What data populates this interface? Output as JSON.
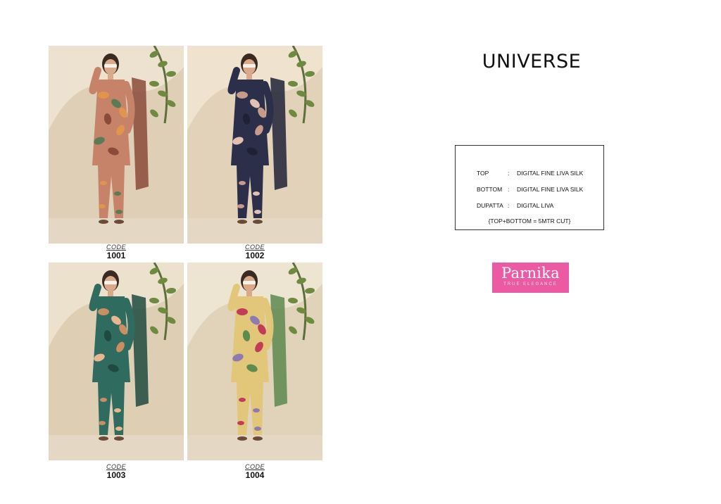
{
  "title": "UNIVERSE",
  "products": [
    {
      "code_word": "CODE",
      "code": "1001",
      "palette": {
        "bg": "#ece2cf",
        "arch": "#d9c8ab",
        "base": "#c7836a",
        "print_a": "#e0944c",
        "print_b": "#5b7a55",
        "print_c": "#8b4a3a"
      }
    },
    {
      "code_word": "CODE",
      "code": "1002",
      "palette": {
        "bg": "#efe3d0",
        "arch": "#ddcbb0",
        "base": "#2b2f4a",
        "print_a": "#c89a8a",
        "print_b": "#e2c1b4",
        "print_c": "#1f2236"
      }
    },
    {
      "code_word": "CODE",
      "code": "1003",
      "palette": {
        "bg": "#ece1cd",
        "arch": "#d8c6a9",
        "base": "#2f6b5e",
        "print_a": "#c98e62",
        "print_b": "#e7b890",
        "print_c": "#1e4a40"
      }
    },
    {
      "code_word": "CODE",
      "code": "1004",
      "palette": {
        "bg": "#eee4d2",
        "arch": "#dccbaf",
        "base": "#e2c77a",
        "print_a": "#c23c58",
        "print_b": "#8d7ab0",
        "print_c": "#5d8a4f"
      }
    }
  ],
  "fabric": {
    "rows": [
      {
        "key": "TOP",
        "sep": ":",
        "value": "DIGITAL FINE LIVA SILK"
      },
      {
        "key": "BOTTOM",
        "sep": ":",
        "value": "DIGITAL FINE LIVA SILK"
      },
      {
        "key": "DUPATTA",
        "sep": ":",
        "value": "DIGITAL LIVA"
      }
    ],
    "note": "{TOP+BOTTOM = 5MTR CUT}"
  },
  "logo": {
    "name": "Parnika",
    "tagline": "TRUE ELEGANCE",
    "color": "#ec5aa3"
  }
}
